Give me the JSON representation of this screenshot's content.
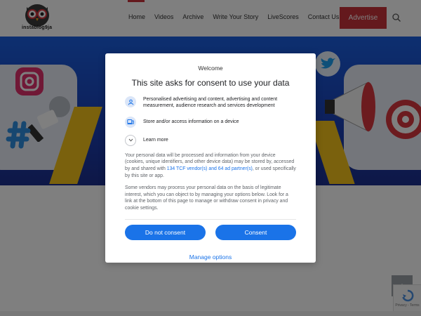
{
  "header": {
    "logo_text": "instablog9ja",
    "nav": [
      "Home",
      "Videos",
      "Archive",
      "Write Your Story",
      "LiveScores",
      "Contact Us"
    ],
    "advertise_label": "Advertise"
  },
  "consent": {
    "brand": "Welcome",
    "title": "This site asks for consent to use your data",
    "purposes": [
      {
        "icon": "person-icon",
        "text": "Personalised advertising and content, advertising and content measurement, audience research and services development"
      },
      {
        "icon": "device-icon",
        "text": "Store and/or access information on a device"
      }
    ],
    "learn_more": "Learn more",
    "paragraph1_pre": "Your personal data will be processed and information from your device (cookies, unique identifiers, and other device data) may be stored by, accessed by and shared with ",
    "paragraph1_link": "134 TCF vendor(s) and 64 ad partner(s)",
    "paragraph1_post": ", or used specifically by this site or app.",
    "paragraph2": "Some vendors may process your personal data on the basis of legitimate interest, which you can object to by managing your options below. Look for a link at the bottom of this page to manage or withdraw consent in privacy and cookie settings.",
    "do_not_consent": "Do not consent",
    "consent": "Consent",
    "manage_options": "Manage options"
  },
  "recaptcha_label": "Privacy - Terms",
  "colors": {
    "accent": "#1a73e8",
    "brand_red": "#c8323a",
    "hero_blue": "#1a3fb4"
  }
}
